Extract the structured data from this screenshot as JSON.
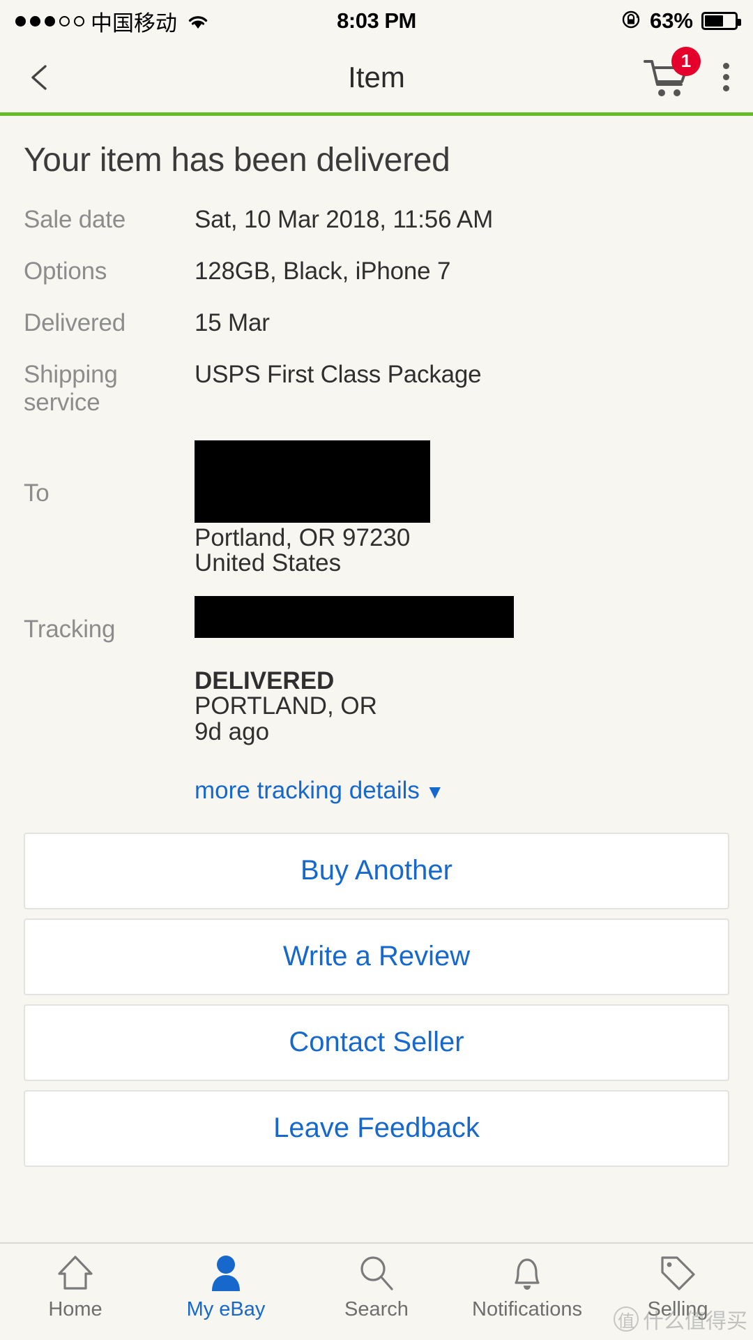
{
  "status_bar": {
    "carrier": "中国移动",
    "signal_dots_filled": 3,
    "signal_dots_total": 5,
    "wifi_icon": "wifi-icon",
    "time": "8:03 PM",
    "rotation_lock_icon": "rotation-lock-icon",
    "battery_percent": "63%",
    "battery_level": 63
  },
  "nav_bar": {
    "back_icon": "back-chevron-icon",
    "title": "Item",
    "cart_icon": "shopping-cart-icon",
    "cart_badge": "1",
    "overflow_icon": "kebab-menu-icon",
    "accent_line_color": "#64bc26"
  },
  "main": {
    "heading": "Your item has been delivered",
    "details": [
      {
        "label": "Sale date",
        "value": "Sat, 10 Mar 2018, 11:56 AM"
      },
      {
        "label": "Options",
        "value": "128GB, Black, iPhone 7"
      },
      {
        "label": "Delivered",
        "value": "15 Mar"
      },
      {
        "label": "Shipping service",
        "value": "USPS First Class Package"
      }
    ],
    "to": {
      "label": "To",
      "redacted_name_address": "",
      "city_state_zip": "Portland, OR 97230",
      "country": "United States"
    },
    "tracking": {
      "label": "Tracking",
      "redacted_number": "",
      "status": "DELIVERED",
      "location": "PORTLAND, OR",
      "time_ago": "9d ago",
      "more_link": "more tracking details",
      "more_link_caret": "▼",
      "link_color": "#1668cd"
    },
    "actions": [
      {
        "label": "Buy Another"
      },
      {
        "label": "Write a Review"
      },
      {
        "label": "Contact Seller"
      },
      {
        "label": "Leave Feedback"
      }
    ]
  },
  "tab_bar": {
    "items": [
      {
        "label": "Home",
        "icon": "home-icon",
        "active": false
      },
      {
        "label": "My eBay",
        "icon": "person-icon",
        "active": true
      },
      {
        "label": "Search",
        "icon": "search-icon",
        "active": false
      },
      {
        "label": "Notifications",
        "icon": "bell-icon",
        "active": false
      },
      {
        "label": "Selling",
        "icon": "tag-icon",
        "active": false
      }
    ],
    "active_color": "#1668cd",
    "inactive_color": "#6e6e6e"
  },
  "watermark": {
    "mark": "值",
    "text": "什么值得买"
  }
}
